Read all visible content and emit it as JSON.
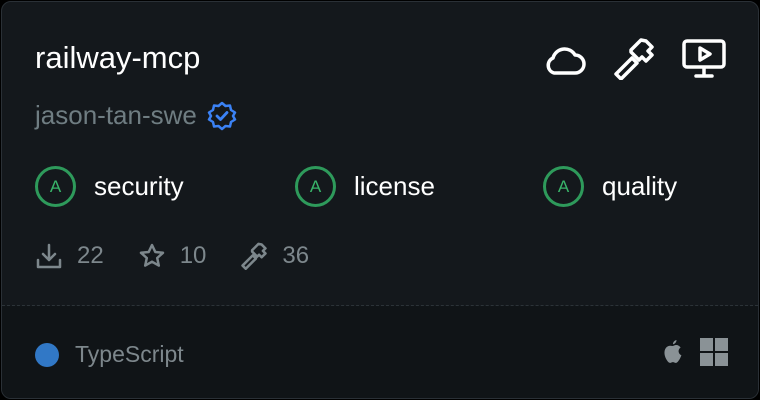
{
  "card": {
    "title": "railway-mcp",
    "author": "jason-tan-swe",
    "top_icons": [
      "cloud-icon",
      "hammer-icon",
      "monitor-play-icon"
    ],
    "scores": [
      {
        "grade": "A",
        "label": "security"
      },
      {
        "grade": "A",
        "label": "license"
      },
      {
        "grade": "A",
        "label": "quality"
      }
    ],
    "stats": {
      "downloads": "22",
      "stars": "10",
      "tools": "36"
    },
    "language": {
      "name": "TypeScript",
      "color": "#3178c6"
    },
    "platforms": [
      "apple-icon",
      "windows-icon"
    ]
  },
  "colors": {
    "background": "#14181c",
    "grade": "#2e9a5b",
    "verified": "#3b82f6"
  }
}
